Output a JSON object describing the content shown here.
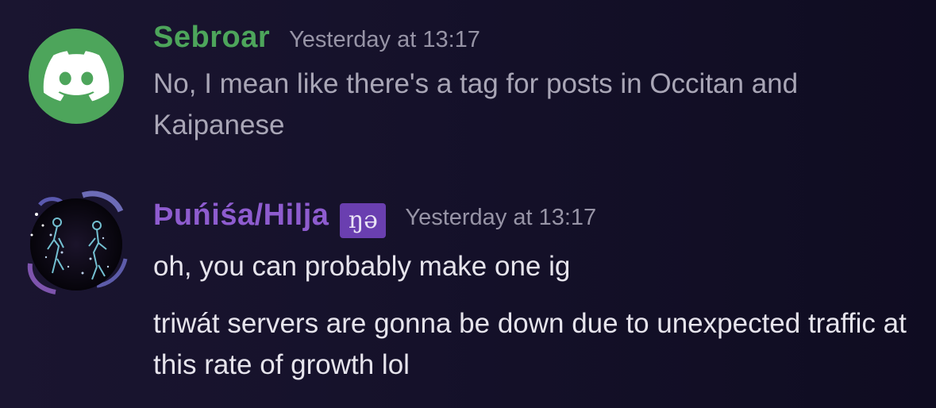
{
  "messages": [
    {
      "username": "Sebroar",
      "timestamp": "Yesterday at 13:17",
      "avatar_icon": "discord-logo-icon",
      "username_color": "#4da55b",
      "lines": [
        "No, I mean like there's a tag for posts in Occitan and Kaipanese"
      ]
    },
    {
      "username": "Þuńiśa/Hilja",
      "role_badge": "ŋə",
      "timestamp": "Yesterday at 13:17",
      "avatar_icon": "user-avatar-art",
      "username_color": "#8e5ccf",
      "lines": [
        "oh, you can probably make one ig",
        "triwát servers are gonna be down due to unexpected traffic at this rate of growth lol"
      ]
    }
  ]
}
